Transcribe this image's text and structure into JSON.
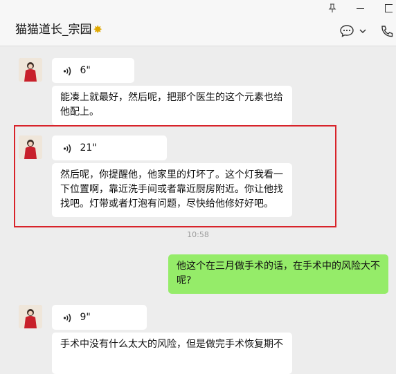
{
  "header": {
    "title": "猫猫道长_宗园",
    "title_emoji": "✸",
    "icons": [
      "pin-icon",
      "minimize-icon",
      "maximize-icon",
      "chat-bubble-icon",
      "chevron-down-icon",
      "phone-icon"
    ]
  },
  "messages": [
    {
      "type": "voice",
      "duration": "6\""
    },
    {
      "type": "text",
      "lines": [
        "能凑上就最好，然后呢，把那个医生的这个元素也给",
        "他配上。"
      ]
    },
    {
      "type": "voice",
      "duration": "21\""
    },
    {
      "type": "text",
      "lines": [
        "然后呢，你提醒他，他家里的灯坏了。这个灯我看一",
        "下位置啊，靠近洗手间或者靠近厨房附近。你让他找",
        "找吧。灯带或者灯泡有问题，尽快给他修好好吧。"
      ]
    },
    {
      "type": "timestamp",
      "text": "10:58"
    },
    {
      "type": "text_self",
      "lines": [
        "他这个在三月做手术的话，在手术中的风险大不",
        "呢?"
      ]
    },
    {
      "type": "voice",
      "duration": "9\""
    },
    {
      "type": "text",
      "lines": [
        "手术中没有什么太大的风险，但是做完手术恢复期不"
      ]
    }
  ],
  "colors": {
    "self_bubble": "#95ec69",
    "other_bubble": "#ffffff",
    "highlight_border": "#d8232a",
    "background": "#ededed"
  }
}
